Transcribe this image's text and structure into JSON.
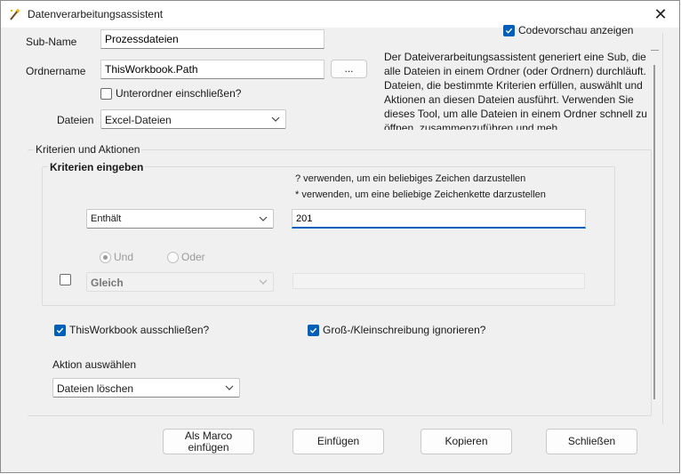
{
  "window": {
    "title": "Datenverarbeitungsassistent",
    "close_glyph": "✕"
  },
  "form": {
    "subname_label": "Sub-Name",
    "subname_value": "Prozessdateien",
    "ordnername_label": "Ordnername",
    "ordnername_value": "ThisWorkbook.Path",
    "browse_label": "...",
    "unterordner_label": "Unterordner einschließen?",
    "unterordner_checked": false,
    "dateien_label": "Dateien",
    "dateien_value": "Excel-Dateien"
  },
  "preview": {
    "label": "Codevorschau anzeigen",
    "checked": true
  },
  "description": "Der Dateiverarbeitungsassistent generiert eine Sub, die alle Dateien in einem Ordner (oder Ordnern) durchläuft. Dateien, die bestimmte Kriterien erfüllen, auswählt und Aktionen an diesen Dateien ausführt. Verwenden Sie dieses Tool, um alle Dateien in einem Ordner schnell zu öffnen, zusammenzuführen und meh",
  "criteria": {
    "group_title": "Kriterien und Aktionen",
    "sub_title": "Kriterien eingeben",
    "hint1": "? verwenden, um ein beliebiges Zeichen darzustellen",
    "hint2": "* verwenden, um eine beliebige Zeichenkette darzustellen",
    "op1_value": "Enthält",
    "value1": "201",
    "und_label": "Und",
    "oder_label": "Oder",
    "op2_value": "Gleich",
    "value2": ""
  },
  "options": {
    "exclude_label": "ThisWorkbook ausschließen?",
    "exclude_checked": true,
    "case_label": "Groß-/Kleinschreibung ignorieren?",
    "case_checked": true
  },
  "action": {
    "label": "Aktion auswählen",
    "value": "Dateien löschen"
  },
  "buttons": {
    "macro": "Als Marco einfügen",
    "insert": "Einfügen",
    "copy": "Kopieren",
    "close": "Schließen"
  },
  "colors": {
    "accent": "#005fb8",
    "background": "#f0f0f0"
  }
}
